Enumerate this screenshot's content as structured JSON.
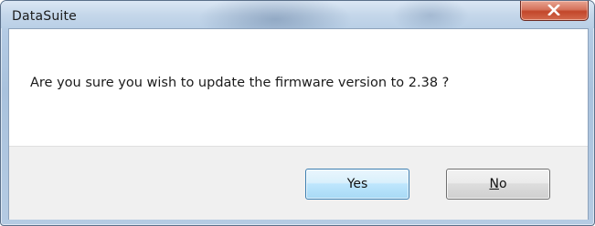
{
  "window": {
    "title": "DataSuite"
  },
  "dialog": {
    "message": "Are you sure you wish to update the firmware version to 2.38 ?"
  },
  "buttons": {
    "yes_label": "Yes",
    "no_label_mnemonic": "N",
    "no_label_rest": "o"
  },
  "icons": {
    "close": "close-icon"
  },
  "colors": {
    "close_button": "#c2462a",
    "default_button_border": "#3c7fb1",
    "button_area": "#f0f0f0"
  }
}
